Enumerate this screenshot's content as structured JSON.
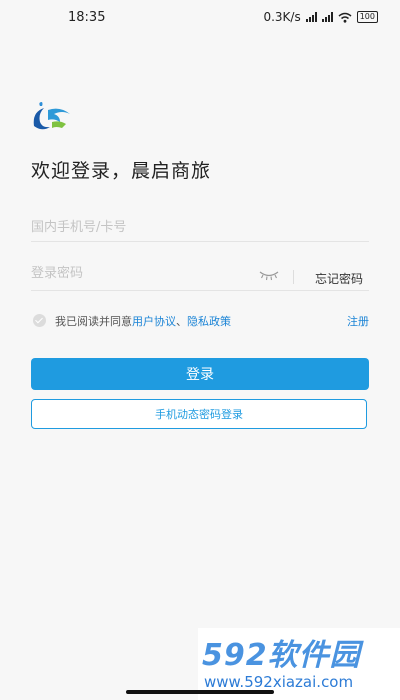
{
  "status_bar": {
    "time": "18:35",
    "net_speed": "0.3K/s",
    "battery": "100"
  },
  "welcome": "欢迎登录，晨启商旅",
  "phone": {
    "placeholder": "国内手机号/卡号",
    "value": ""
  },
  "password": {
    "placeholder": "登录密码",
    "value": ""
  },
  "forgot_password": "忘记密码",
  "agreement": {
    "prefix": "我已阅读并同意",
    "user_agreement": "用户协议",
    "separator": "、",
    "privacy_policy": "隐私政策",
    "checked": false
  },
  "register": "注册",
  "login_button": "登录",
  "sms_login_button": "手机动态密码登录",
  "watermark": {
    "brand": "592软件园",
    "url": "www.592xiazai.com"
  },
  "colors": {
    "primary": "#1f9be0",
    "link": "#1b84d6",
    "background": "#f7f7f7"
  },
  "icons": [
    "signal-icon",
    "wifi-icon",
    "battery-icon",
    "app-logo-icon",
    "eye-closed-icon",
    "check-icon"
  ]
}
